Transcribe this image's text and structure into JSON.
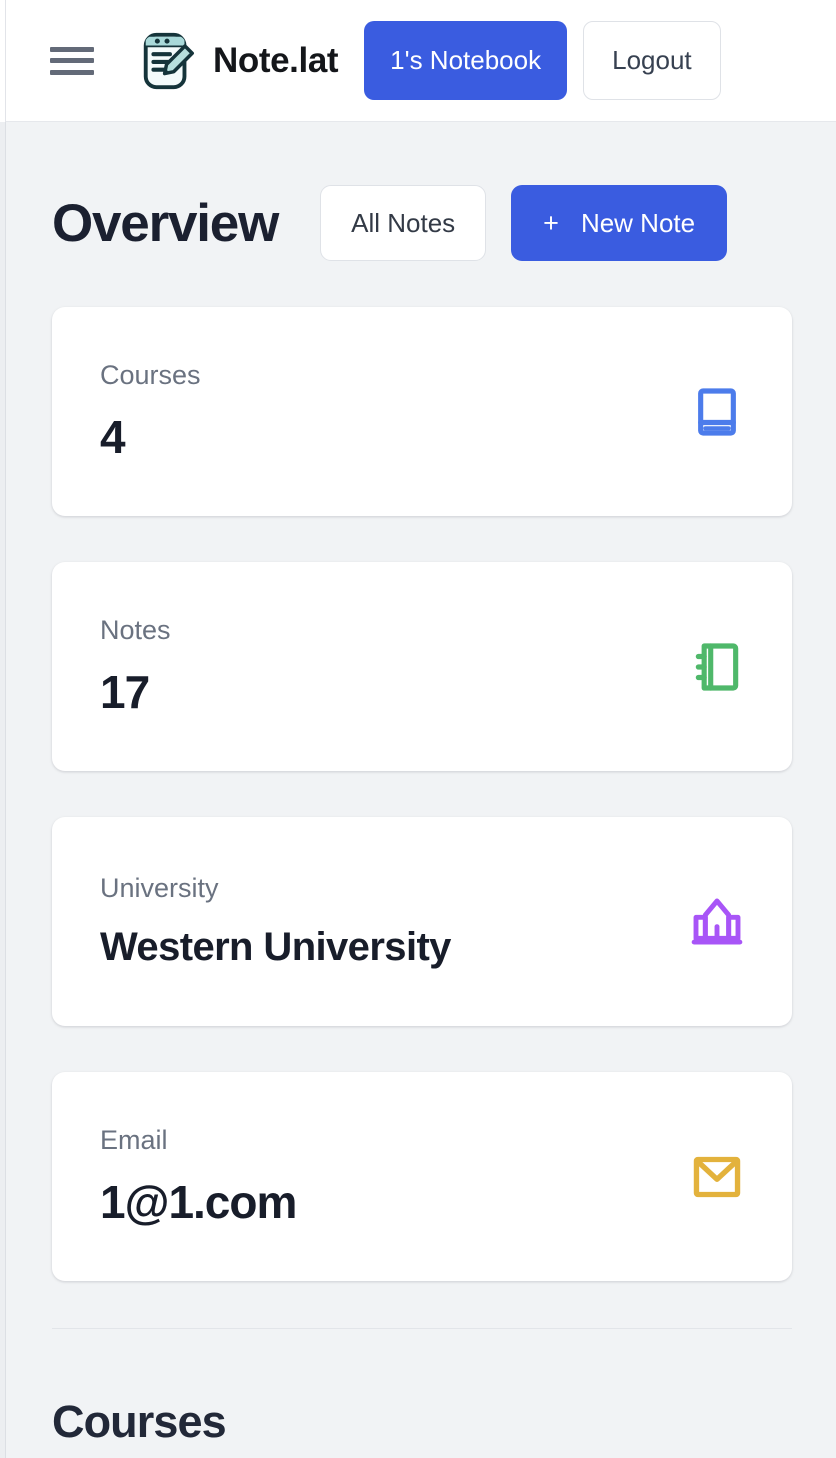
{
  "header": {
    "menu_icon": "hamburger-menu-icon",
    "logo_icon": "notepad-pencil-logo-icon",
    "brand_name": "Note.lat",
    "notebook_button": "1's Notebook",
    "logout_button": "Logout"
  },
  "colors": {
    "accent_blue": "#3a5ce0",
    "page_background": "#f1f3f5",
    "card_background": "#ffffff",
    "label_gray": "#6a7280",
    "value_dark": "#181d2a",
    "icon_courses_blue": "#4c7ceb",
    "icon_notes_green": "#4fb86a",
    "icon_university_purple": "#a855f7",
    "icon_email_amber": "#e3b23c"
  },
  "overview": {
    "title": "Overview",
    "all_notes_button": "All Notes",
    "new_note_button": "New Note",
    "new_note_plus": "+"
  },
  "stats": [
    {
      "label": "Courses",
      "value": "4",
      "icon": "book-icon",
      "icon_color": "#4c7ceb"
    },
    {
      "label": "Notes",
      "value": "17",
      "icon": "notebook-icon",
      "icon_color": "#4fb86a"
    },
    {
      "label": "University",
      "value": "Western University",
      "icon": "landmark-icon",
      "icon_color": "#a855f7"
    },
    {
      "label": "Email",
      "value": "1@1.com",
      "icon": "envelope-icon",
      "icon_color": "#e3b23c"
    }
  ],
  "courses_section": {
    "title": "Courses"
  }
}
